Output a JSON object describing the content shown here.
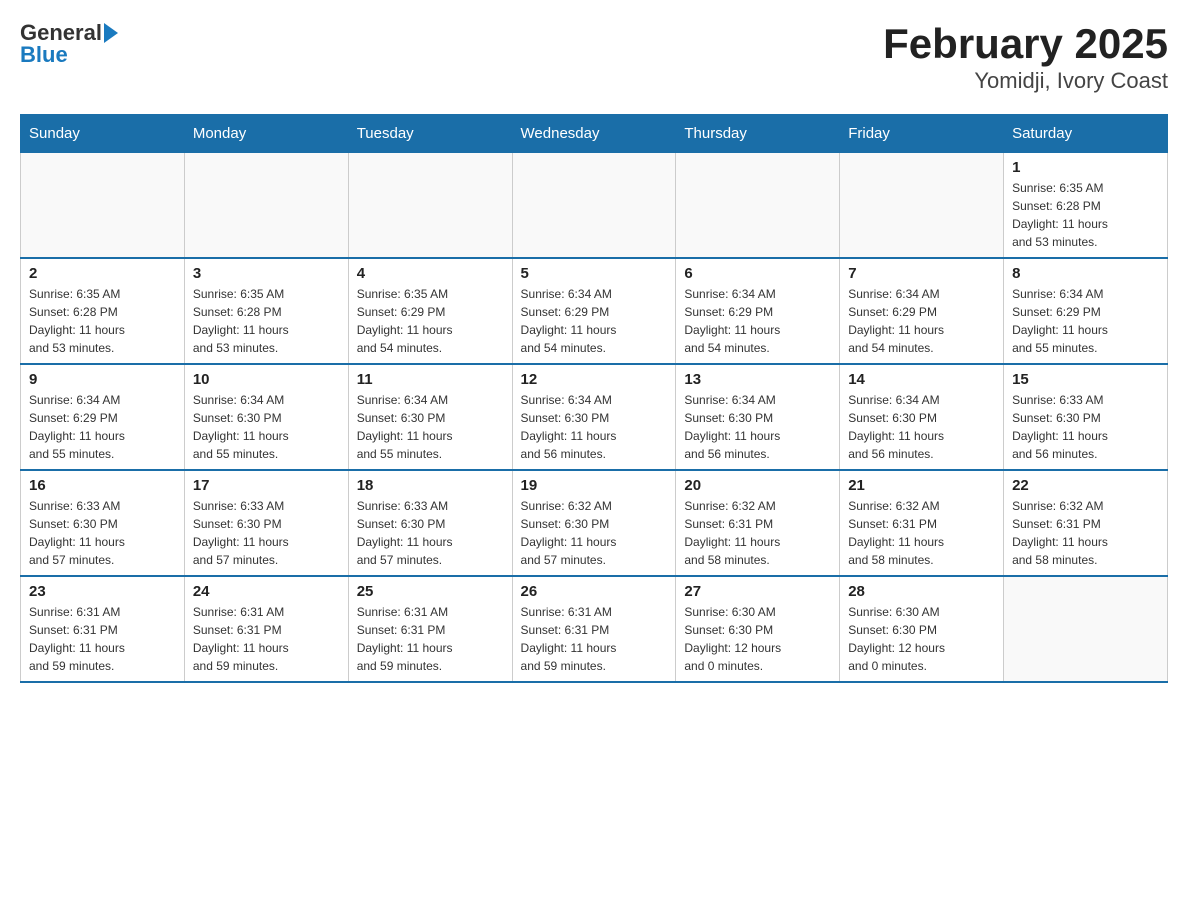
{
  "header": {
    "logo_general": "General",
    "logo_blue": "Blue",
    "title": "February 2025",
    "subtitle": "Yomidji, Ivory Coast"
  },
  "calendar": {
    "days_of_week": [
      "Sunday",
      "Monday",
      "Tuesday",
      "Wednesday",
      "Thursday",
      "Friday",
      "Saturday"
    ],
    "weeks": [
      [
        {
          "day": "",
          "info": ""
        },
        {
          "day": "",
          "info": ""
        },
        {
          "day": "",
          "info": ""
        },
        {
          "day": "",
          "info": ""
        },
        {
          "day": "",
          "info": ""
        },
        {
          "day": "",
          "info": ""
        },
        {
          "day": "1",
          "info": "Sunrise: 6:35 AM\nSunset: 6:28 PM\nDaylight: 11 hours\nand 53 minutes."
        }
      ],
      [
        {
          "day": "2",
          "info": "Sunrise: 6:35 AM\nSunset: 6:28 PM\nDaylight: 11 hours\nand 53 minutes."
        },
        {
          "day": "3",
          "info": "Sunrise: 6:35 AM\nSunset: 6:28 PM\nDaylight: 11 hours\nand 53 minutes."
        },
        {
          "day": "4",
          "info": "Sunrise: 6:35 AM\nSunset: 6:29 PM\nDaylight: 11 hours\nand 54 minutes."
        },
        {
          "day": "5",
          "info": "Sunrise: 6:34 AM\nSunset: 6:29 PM\nDaylight: 11 hours\nand 54 minutes."
        },
        {
          "day": "6",
          "info": "Sunrise: 6:34 AM\nSunset: 6:29 PM\nDaylight: 11 hours\nand 54 minutes."
        },
        {
          "day": "7",
          "info": "Sunrise: 6:34 AM\nSunset: 6:29 PM\nDaylight: 11 hours\nand 54 minutes."
        },
        {
          "day": "8",
          "info": "Sunrise: 6:34 AM\nSunset: 6:29 PM\nDaylight: 11 hours\nand 55 minutes."
        }
      ],
      [
        {
          "day": "9",
          "info": "Sunrise: 6:34 AM\nSunset: 6:29 PM\nDaylight: 11 hours\nand 55 minutes."
        },
        {
          "day": "10",
          "info": "Sunrise: 6:34 AM\nSunset: 6:30 PM\nDaylight: 11 hours\nand 55 minutes."
        },
        {
          "day": "11",
          "info": "Sunrise: 6:34 AM\nSunset: 6:30 PM\nDaylight: 11 hours\nand 55 minutes."
        },
        {
          "day": "12",
          "info": "Sunrise: 6:34 AM\nSunset: 6:30 PM\nDaylight: 11 hours\nand 56 minutes."
        },
        {
          "day": "13",
          "info": "Sunrise: 6:34 AM\nSunset: 6:30 PM\nDaylight: 11 hours\nand 56 minutes."
        },
        {
          "day": "14",
          "info": "Sunrise: 6:34 AM\nSunset: 6:30 PM\nDaylight: 11 hours\nand 56 minutes."
        },
        {
          "day": "15",
          "info": "Sunrise: 6:33 AM\nSunset: 6:30 PM\nDaylight: 11 hours\nand 56 minutes."
        }
      ],
      [
        {
          "day": "16",
          "info": "Sunrise: 6:33 AM\nSunset: 6:30 PM\nDaylight: 11 hours\nand 57 minutes."
        },
        {
          "day": "17",
          "info": "Sunrise: 6:33 AM\nSunset: 6:30 PM\nDaylight: 11 hours\nand 57 minutes."
        },
        {
          "day": "18",
          "info": "Sunrise: 6:33 AM\nSunset: 6:30 PM\nDaylight: 11 hours\nand 57 minutes."
        },
        {
          "day": "19",
          "info": "Sunrise: 6:32 AM\nSunset: 6:30 PM\nDaylight: 11 hours\nand 57 minutes."
        },
        {
          "day": "20",
          "info": "Sunrise: 6:32 AM\nSunset: 6:31 PM\nDaylight: 11 hours\nand 58 minutes."
        },
        {
          "day": "21",
          "info": "Sunrise: 6:32 AM\nSunset: 6:31 PM\nDaylight: 11 hours\nand 58 minutes."
        },
        {
          "day": "22",
          "info": "Sunrise: 6:32 AM\nSunset: 6:31 PM\nDaylight: 11 hours\nand 58 minutes."
        }
      ],
      [
        {
          "day": "23",
          "info": "Sunrise: 6:31 AM\nSunset: 6:31 PM\nDaylight: 11 hours\nand 59 minutes."
        },
        {
          "day": "24",
          "info": "Sunrise: 6:31 AM\nSunset: 6:31 PM\nDaylight: 11 hours\nand 59 minutes."
        },
        {
          "day": "25",
          "info": "Sunrise: 6:31 AM\nSunset: 6:31 PM\nDaylight: 11 hours\nand 59 minutes."
        },
        {
          "day": "26",
          "info": "Sunrise: 6:31 AM\nSunset: 6:31 PM\nDaylight: 11 hours\nand 59 minutes."
        },
        {
          "day": "27",
          "info": "Sunrise: 6:30 AM\nSunset: 6:30 PM\nDaylight: 12 hours\nand 0 minutes."
        },
        {
          "day": "28",
          "info": "Sunrise: 6:30 AM\nSunset: 6:30 PM\nDaylight: 12 hours\nand 0 minutes."
        },
        {
          "day": "",
          "info": ""
        }
      ]
    ]
  }
}
